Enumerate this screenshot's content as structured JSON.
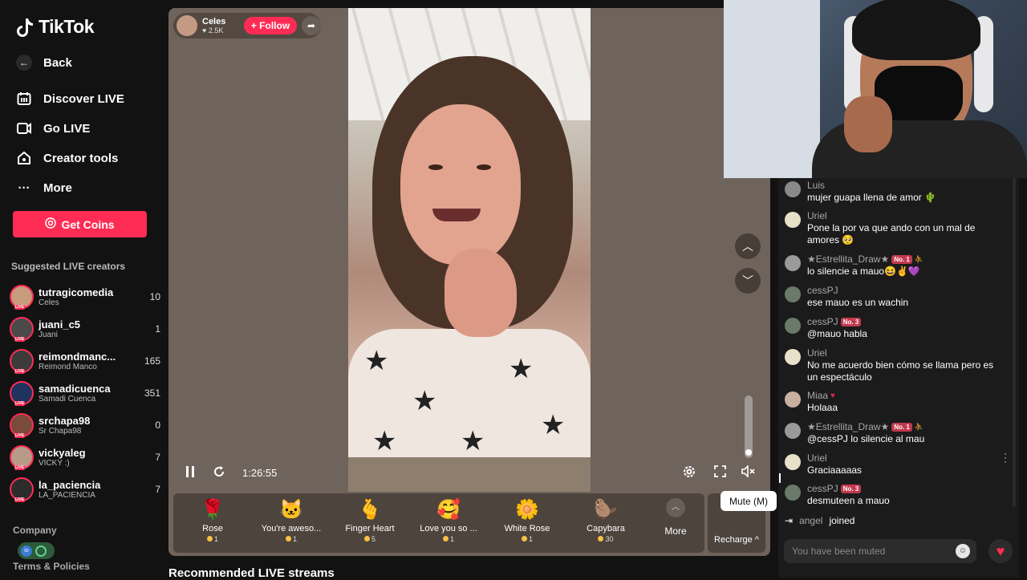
{
  "app": {
    "name": "TikTok"
  },
  "nav": {
    "back": "Back",
    "items": [
      "Discover LIVE",
      "Go LIVE",
      "Creator tools",
      "More"
    ],
    "coins_button": "Get Coins"
  },
  "suggested": {
    "title": "Suggested LIVE creators",
    "creators": [
      {
        "name": "tutragicomedia",
        "sub": "Celes",
        "count": "10",
        "color": "#c79b7c"
      },
      {
        "name": "juani_c5",
        "sub": "Juani",
        "count": "1",
        "color": "#4a4a4a"
      },
      {
        "name": "reimondmanc...",
        "sub": "Reimond Manco",
        "count": "165",
        "color": "#3b3b3b"
      },
      {
        "name": "samadicuenca",
        "sub": "Samadi Cuenca",
        "count": "351",
        "color": "#20325e"
      },
      {
        "name": "srchapa98",
        "sub": "Sr Chapa98",
        "count": "0",
        "color": "#7a4a3a"
      },
      {
        "name": "vickyaleg",
        "sub": "VICKY :)",
        "count": "7",
        "color": "#b89a88"
      },
      {
        "name": "la_paciencia",
        "sub": "LA_PACIENCIA",
        "count": "7",
        "color": "#2c2c2c"
      }
    ]
  },
  "footer": {
    "company": "Company",
    "terms": "Terms & Policies"
  },
  "player": {
    "host_name": "Celes",
    "host_likes": "2.5K",
    "follow": "+ Follow",
    "time": "1:26:55",
    "volume_level": 0.05,
    "tooltip": "Mute (M)"
  },
  "gifts": [
    {
      "name": "Rose",
      "price": "1",
      "emoji": "🌹"
    },
    {
      "name": "You're aweso...",
      "price": "1",
      "emoji": "🐱"
    },
    {
      "name": "Finger Heart",
      "price": "5",
      "emoji": "🫰"
    },
    {
      "name": "Love you so ...",
      "price": "1",
      "emoji": "🥰"
    },
    {
      "name": "White Rose",
      "price": "1",
      "emoji": "🌼"
    },
    {
      "name": "Capybara",
      "price": "30",
      "emoji": "🦫"
    }
  ],
  "gift_more": "More",
  "recharge": "Recharge ^",
  "recommended": "Recommended LIVE streams",
  "chat": {
    "messages": [
      {
        "user": "Luis",
        "text": "mujer guapa llena de amor 🌵",
        "badge": "",
        "color": "#8a8a8a"
      },
      {
        "user": "Uriel",
        "text": "Pone la por va que ando con un mal de amores 🥺",
        "badge": "",
        "color": "#e8e0c8"
      },
      {
        "user": "★Estrellita_Draw★",
        "text": "lo silencie a mauo😆✌💜",
        "badge": "No. 1",
        "color": "#9a9a9a"
      },
      {
        "user": "cessPJ",
        "text": "ese mauo es un wachin",
        "badge": "",
        "color": "#6a7a6a"
      },
      {
        "user": "cessPJ",
        "text": "@mauo habla",
        "badge": "No. 3",
        "color": "#6a7a6a"
      },
      {
        "user": "Uriel",
        "text": "No me acuerdo bien cómo se llama pero es un espectáculo",
        "badge": "",
        "color": "#e8e0c8"
      },
      {
        "user": "Miaa",
        "text": "Holaaa",
        "badge": "",
        "color": "#c8b0a0"
      },
      {
        "user": "★Estrellita_Draw★",
        "text": "@cessPJ lo silencie al mau",
        "badge": "No. 1",
        "color": "#9a9a9a"
      },
      {
        "user": "Uriel",
        "text": "Graciaaaaas",
        "badge": "",
        "color": "#e8e0c8"
      },
      {
        "user": "cessPJ",
        "text": "desmuteen a mauo",
        "badge": "No. 3",
        "color": "#6a7a6a"
      }
    ],
    "joined_user": "angel",
    "joined_text": "joined",
    "input_placeholder": "You have been muted"
  },
  "colors": {
    "accent": "#fe2c55",
    "player_bg": "#6f645c"
  }
}
